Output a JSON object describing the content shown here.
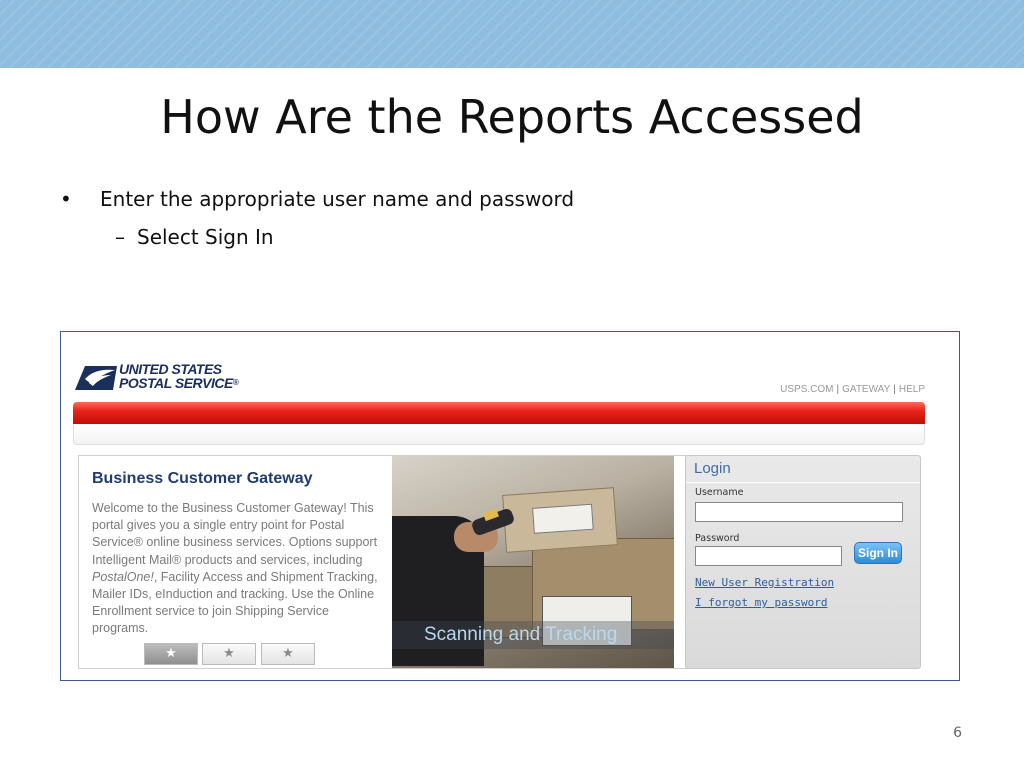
{
  "slide": {
    "title": "How Are the Reports Accessed",
    "bullet_mark": "•",
    "bullet_text": "Enter the appropriate user name and password",
    "sub_mark": "–",
    "sub_text": "Select Sign In",
    "page_number": "6"
  },
  "usps": {
    "logo_line1": "UNITED STATES",
    "logo_line2": "POSTAL SERVICE",
    "logo_mark": "®",
    "links": [
      "USPS.COM",
      "GATEWAY",
      "HELP"
    ],
    "link_separator": "|"
  },
  "gateway": {
    "title": "Business Customer Gateway",
    "desc_1": "Welcome to the Business Customer Gateway! This portal gives you a single entry point for Postal Service® online business services. Options support Intelligent Mail® products and services, including ",
    "desc_italic": "PostalOne!",
    "desc_2": ", Facility Access and Shipment Tracking, Mailer IDs, eInduction and tracking. Use the Online Enrollment service to join Shipping Service programs.",
    "photo_caption": "Scanning and Tracking",
    "carousel": [
      "★",
      "★",
      "★"
    ],
    "carousel_active_index": 0
  },
  "login": {
    "title": "Login",
    "username_label": "Username",
    "username_value": "",
    "password_label": "Password",
    "password_value": "",
    "sign_in_label": "Sign In",
    "new_user_link": "New User Registration",
    "forgot_link": "I forgot my password"
  },
  "colors": {
    "top_band": "#8ebde0",
    "usps_blue": "#1f3d70",
    "red_bar": "#e8241a",
    "link_blue": "#2f5d9e",
    "button_blue": "#2f8bd6"
  }
}
